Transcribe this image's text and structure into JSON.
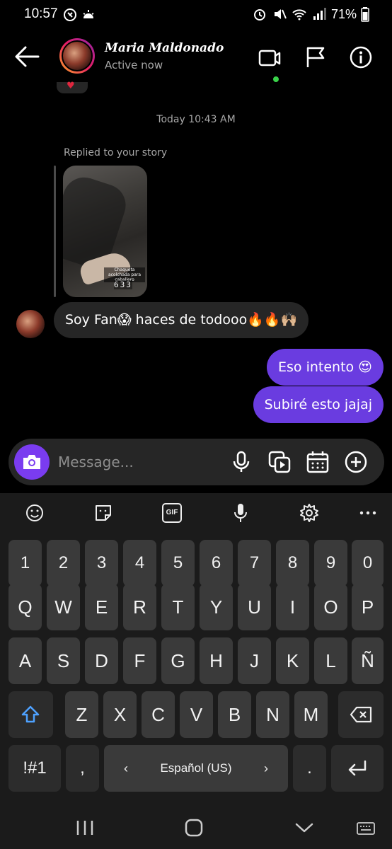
{
  "status_bar": {
    "time": "10:57",
    "battery": "71%",
    "icons": [
      "whatsapp-icon",
      "weather-icon",
      "alarm-icon",
      "mute-icon",
      "wifi-icon",
      "signal-icon",
      "battery-icon"
    ]
  },
  "header": {
    "contact_name": "Maria Maldonado",
    "contact_status": "Active now",
    "icons": [
      "back-arrow-icon",
      "video-call-icon",
      "flag-icon",
      "info-icon"
    ],
    "online_color": "#3ad34a"
  },
  "chat": {
    "timestamp": "Today 10:43 AM",
    "replied_label": "Replied to your story",
    "story_caption": "Chaqueta acolchada para caballero",
    "story_counter": "633",
    "messages": [
      {
        "from": "them",
        "text": "Soy Fan😱 haces de todooo🔥🔥🙌🏼"
      },
      {
        "from": "me",
        "text": "Eso intento 😍"
      },
      {
        "from": "me",
        "text": "Subiré esto jajaj"
      }
    ],
    "outgoing_color": "#6a3ce0",
    "incoming_color": "#262626"
  },
  "composer": {
    "placeholder": "Message...",
    "icons": [
      "camera-icon",
      "microphone-icon",
      "gallery-icon",
      "calendar-icon",
      "add-icon"
    ]
  },
  "keyboard": {
    "toolbar_icons": [
      "emoji-icon",
      "sticker-icon",
      "gif-icon",
      "voice-icon",
      "settings-icon",
      "more-icon"
    ],
    "gif_label": "GIF",
    "rows": [
      [
        "1",
        "2",
        "3",
        "4",
        "5",
        "6",
        "7",
        "8",
        "9",
        "0"
      ],
      [
        "Q",
        "W",
        "E",
        "R",
        "T",
        "Y",
        "U",
        "I",
        "O",
        "P"
      ],
      [
        "A",
        "S",
        "D",
        "F",
        "G",
        "H",
        "J",
        "K",
        "L",
        "Ñ"
      ],
      [
        "Z",
        "X",
        "C",
        "V",
        "B",
        "N",
        "M"
      ]
    ],
    "symbols_label": "!#1",
    "comma_label": ",",
    "period_label": ".",
    "language_label": "Español (US)"
  },
  "navbar": {
    "icons": [
      "recents-icon",
      "home-icon",
      "back-icon",
      "keyboard-switch-icon"
    ]
  }
}
